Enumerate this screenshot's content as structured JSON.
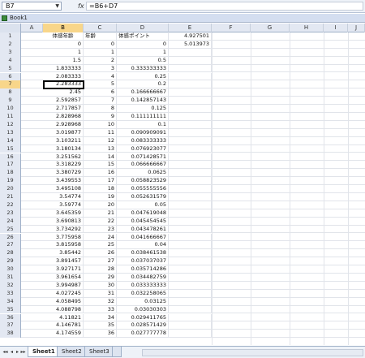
{
  "formula_bar": {
    "name_box": "B7",
    "fx": "fx",
    "formula": "=B6+D7"
  },
  "title_bar": {
    "title": "Book1"
  },
  "columns": [
    "A",
    "B",
    "C",
    "D",
    "E",
    "F",
    "G",
    "H",
    "I",
    "J"
  ],
  "header_row": {
    "b": "体感年齢",
    "c": "年齢",
    "d": "体感ポイント",
    "e": "4.927501"
  },
  "rows": [
    {
      "r": "1",
      "b": "体感年齢",
      "c": "年齢",
      "d": "体感ポイント",
      "e": "4.927501"
    },
    {
      "r": "2",
      "b": "0",
      "c": "0",
      "d": "0",
      "e": "5.013973"
    },
    {
      "r": "3",
      "b": "1",
      "c": "1",
      "d": "1",
      "e": ""
    },
    {
      "r": "4",
      "b": "1.5",
      "c": "2",
      "d": "0.5",
      "e": ""
    },
    {
      "r": "5",
      "b": "1.833333",
      "c": "3",
      "d": "0.333333333",
      "e": ""
    },
    {
      "r": "6",
      "b": "2.083333",
      "c": "4",
      "d": "0.25",
      "e": ""
    },
    {
      "r": "7",
      "b": "2.283333",
      "c": "5",
      "d": "0.2",
      "e": ""
    },
    {
      "r": "8",
      "b": "2.45",
      "c": "6",
      "d": "0.166666667",
      "e": ""
    },
    {
      "r": "9",
      "b": "2.592857",
      "c": "7",
      "d": "0.142857143",
      "e": ""
    },
    {
      "r": "10",
      "b": "2.717857",
      "c": "8",
      "d": "0.125",
      "e": ""
    },
    {
      "r": "11",
      "b": "2.828968",
      "c": "9",
      "d": "0.111111111",
      "e": ""
    },
    {
      "r": "12",
      "b": "2.928968",
      "c": "10",
      "d": "0.1",
      "e": ""
    },
    {
      "r": "13",
      "b": "3.019877",
      "c": "11",
      "d": "0.090909091",
      "e": ""
    },
    {
      "r": "14",
      "b": "3.103211",
      "c": "12",
      "d": "0.083333333",
      "e": ""
    },
    {
      "r": "15",
      "b": "3.180134",
      "c": "13",
      "d": "0.076923077",
      "e": ""
    },
    {
      "r": "16",
      "b": "3.251562",
      "c": "14",
      "d": "0.071428571",
      "e": ""
    },
    {
      "r": "17",
      "b": "3.318229",
      "c": "15",
      "d": "0.066666667",
      "e": ""
    },
    {
      "r": "18",
      "b": "3.380729",
      "c": "16",
      "d": "0.0625",
      "e": ""
    },
    {
      "r": "19",
      "b": "3.439553",
      "c": "17",
      "d": "0.058823529",
      "e": ""
    },
    {
      "r": "20",
      "b": "3.495108",
      "c": "18",
      "d": "0.055555556",
      "e": ""
    },
    {
      "r": "21",
      "b": "3.54774",
      "c": "19",
      "d": "0.052631579",
      "e": ""
    },
    {
      "r": "22",
      "b": "3.59774",
      "c": "20",
      "d": "0.05",
      "e": ""
    },
    {
      "r": "23",
      "b": "3.645359",
      "c": "21",
      "d": "0.047619048",
      "e": ""
    },
    {
      "r": "24",
      "b": "3.690813",
      "c": "22",
      "d": "0.045454545",
      "e": ""
    },
    {
      "r": "25",
      "b": "3.734292",
      "c": "23",
      "d": "0.043478261",
      "e": ""
    },
    {
      "r": "26",
      "b": "3.775958",
      "c": "24",
      "d": "0.041666667",
      "e": ""
    },
    {
      "r": "27",
      "b": "3.815958",
      "c": "25",
      "d": "0.04",
      "e": ""
    },
    {
      "r": "28",
      "b": "3.85442",
      "c": "26",
      "d": "0.038461538",
      "e": ""
    },
    {
      "r": "29",
      "b": "3.891457",
      "c": "27",
      "d": "0.037037037",
      "e": ""
    },
    {
      "r": "30",
      "b": "3.927171",
      "c": "28",
      "d": "0.035714286",
      "e": ""
    },
    {
      "r": "31",
      "b": "3.961654",
      "c": "29",
      "d": "0.034482759",
      "e": ""
    },
    {
      "r": "32",
      "b": "3.994987",
      "c": "30",
      "d": "0.033333333",
      "e": ""
    },
    {
      "r": "33",
      "b": "4.027245",
      "c": "31",
      "d": "0.032258065",
      "e": ""
    },
    {
      "r": "34",
      "b": "4.058495",
      "c": "32",
      "d": "0.03125",
      "e": ""
    },
    {
      "r": "35",
      "b": "4.088798",
      "c": "33",
      "d": "0.03030303",
      "e": ""
    },
    {
      "r": "36",
      "b": "4.11821",
      "c": "34",
      "d": "0.029411765",
      "e": ""
    },
    {
      "r": "37",
      "b": "4.146781",
      "c": "35",
      "d": "0.028571429",
      "e": ""
    },
    {
      "r": "38",
      "b": "4.174559",
      "c": "36",
      "d": "0.027777778",
      "e": ""
    }
  ],
  "tabs": [
    "Sheet1",
    "Sheet2",
    "Sheet3"
  ],
  "nav": [
    "◂◂",
    "◂",
    "▸",
    "▸▸"
  ],
  "active_cell": {
    "row": "7",
    "col": "B"
  }
}
